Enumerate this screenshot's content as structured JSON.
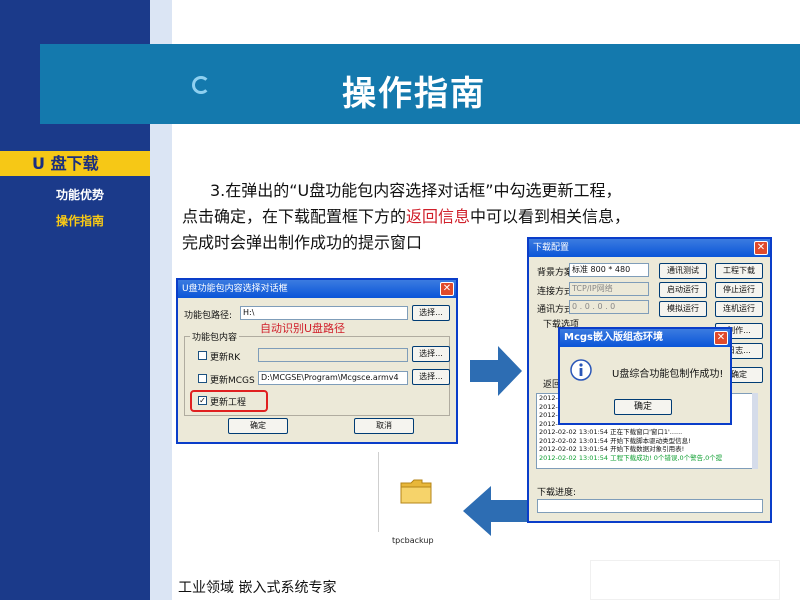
{
  "header": {
    "title": "操作指南"
  },
  "nav": {
    "header": "U 盘下载",
    "items": [
      {
        "label": "功能优势"
      },
      {
        "label": "操作指南"
      }
    ]
  },
  "body": {
    "line1": "3.在弹出的“U盘功能包内容选择对话框”中勾选更新工程，",
    "line2_pre": "点击确定，在下载配置框下方的",
    "line2_red": "返回信息",
    "line2_post": "中可以看到相关信息，",
    "line3": "完成时会弹出制作成功的提示窗口"
  },
  "dialog1": {
    "title": "U盘功能包内容选择对话框",
    "path_label": "功能包路径:",
    "path_value": "H:\\",
    "select_btn": "选择...",
    "annotation": "自动识别U盘路径",
    "group_label": "功能包内容",
    "opt1": "更新RK",
    "opt2": "更新MCGS",
    "opt2_path": "D:\\MCGSE\\Program\\Mcgsce.armv4",
    "opt3": "更新工程",
    "ok": "确定",
    "cancel": "取消"
  },
  "dialog2": {
    "title": "下载配置",
    "scheme_label": "背景方案",
    "scheme_value": "标准 800 * 480",
    "connect_label": "连接方式",
    "connect_value": "TCP/IP网络",
    "comm_label": "通讯方式",
    "comm_value": "0 . 0 . 0 . 0",
    "download_options": "下载选项",
    "btn_comm_test": "通讯测试",
    "btn_download": "工程下载",
    "btn_start": "启动运行",
    "btn_stop": "停止运行",
    "btn_simulate": "模拟运行",
    "btn_connect": "连机运行",
    "btn_making": "制作...",
    "btn_log": "日志...",
    "btn_ok": "确定",
    "return_label": "返回",
    "log": [
      "2012-",
      "2012-",
      "2012-",
      "2012-",
      "2012-02-02 13:01:54  正在下载窗口'窗口1'......",
      "2012-02-02 13:01:54  开始下载脚本驱动类型信息!",
      "2012-02-02 13:01:54  开始下载数据对象引用表!",
      "2012-02-02 13:01:54  工程下载成功! 0个错误,0个警告,0个提"
    ],
    "progress_label": "下载进度:"
  },
  "popup": {
    "title": "Mcgs嵌入版组态环境",
    "message": "U盘综合功能包制作成功!",
    "ok": "确定"
  },
  "folder": {
    "label": "tpcbackup"
  },
  "footer": {
    "text": "工业领域  嵌入式系统专家"
  },
  "colors": {
    "side_dark": "#1b3a8a",
    "header_blue": "#1479ad",
    "nav_yellow": "#f6c816",
    "highlight_red": "#d0202b",
    "arrow_blue": "#2d6db3"
  }
}
